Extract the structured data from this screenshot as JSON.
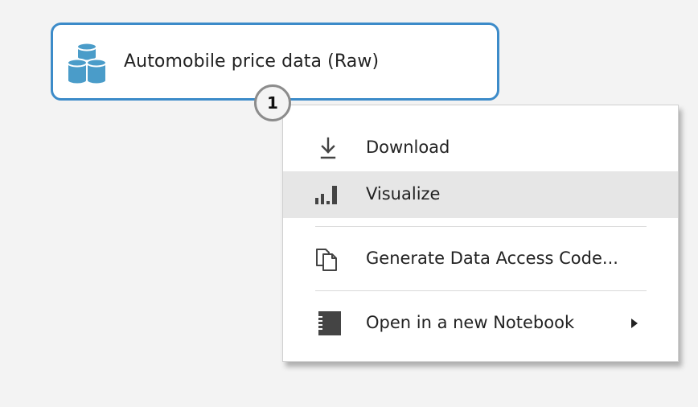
{
  "module": {
    "title": "Automobile price data (Raw)",
    "icon": "dataset-cylinders-icon",
    "border_color": "#3c8bc9",
    "icon_color": "#4a9cc9"
  },
  "output_port": {
    "label": "1"
  },
  "context_menu": {
    "items": [
      {
        "label": "Download",
        "icon": "download-icon",
        "highlighted": false
      },
      {
        "label": "Visualize",
        "icon": "bar-chart-icon",
        "highlighted": true
      },
      {
        "label": "Generate Data Access Code...",
        "icon": "copy-documents-icon",
        "highlighted": false
      },
      {
        "label": "Open in a new Notebook",
        "icon": "notebook-icon",
        "highlighted": false,
        "has_submenu": true
      }
    ],
    "highlight_color": "#e6e6e6"
  }
}
